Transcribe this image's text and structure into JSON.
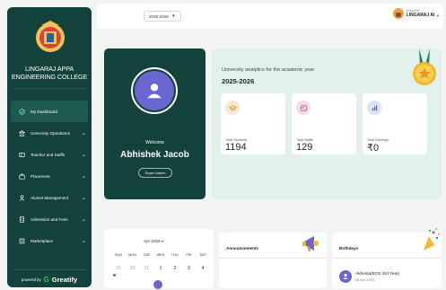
{
  "sidebar": {
    "college_line1": "LINGARAJ APPA",
    "college_line2": "ENGINEERING COLLEGE",
    "items": [
      {
        "label": "My Dashboard",
        "icon": "dashboard-icon",
        "active": true
      },
      {
        "label": "University Operations",
        "icon": "bank-icon"
      },
      {
        "label": "Teacher and Staffs",
        "icon": "id-card-icon"
      },
      {
        "label": "Placement",
        "icon": "briefcase-icon"
      },
      {
        "label": "Alumni Management",
        "icon": "person-icon"
      },
      {
        "label": "Admission and Fees",
        "icon": "document-icon"
      },
      {
        "label": "Marketplace",
        "icon": "store-icon"
      }
    ],
    "powered_by": "powered by",
    "brand": "Greatify"
  },
  "topbar": {
    "year": "2025-2026",
    "welcome": "Welcome",
    "user_name": "LINGARAJ AI"
  },
  "profile": {
    "welcome": "Welcome",
    "name": "Abhishek Jacob",
    "role": "Super Admin"
  },
  "analytics": {
    "title": "University analytics for the academic year",
    "year": "2025-2026",
    "stats": [
      {
        "label": "Total Students",
        "value": "1194",
        "icon": "graduation-icon",
        "color": "#f6e9d2"
      },
      {
        "label": "Total Staffs",
        "value": "129",
        "icon": "staff-icon",
        "color": "#f6dbe8"
      },
      {
        "label": "Total Earnings",
        "value": "₹0",
        "icon": "chart-icon",
        "color": "#dbe4f7"
      }
    ]
  },
  "calendar": {
    "month": "Apr 2026",
    "days": [
      "SUN",
      "MON",
      "TUE",
      "WED",
      "THU",
      "FRI",
      "SAT"
    ],
    "dates": [
      "29",
      "30",
      "31",
      "1",
      "2",
      "3",
      "4"
    ]
  },
  "announcements": {
    "title": "Announcements"
  },
  "birthdays": {
    "title": "Birthdays",
    "entries": [
      {
        "name": "Akhesla(ECE 3rd Year)",
        "date": "08 Apr, 2004"
      }
    ]
  }
}
